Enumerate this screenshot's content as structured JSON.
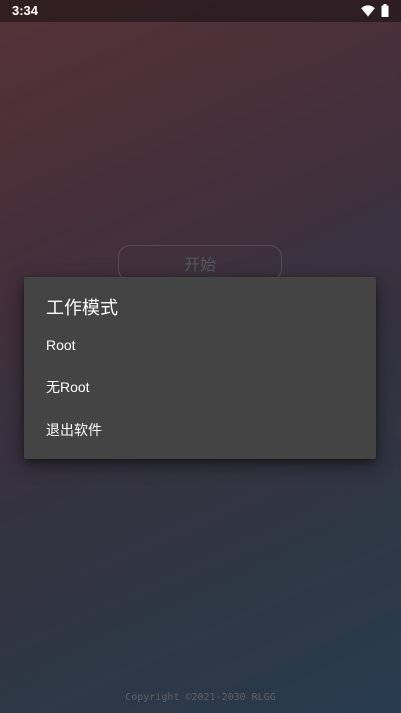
{
  "status_bar": {
    "time": "3:34",
    "icons": [
      "wifi-icon",
      "battery-icon"
    ]
  },
  "main": {
    "start_button_label": "开始"
  },
  "dialog": {
    "title": "工作模式",
    "items": [
      {
        "label": "Root"
      },
      {
        "label": "无Root"
      },
      {
        "label": "退出软件"
      }
    ]
  },
  "footer": {
    "copyright": "Copyright ©2021-2030 RLGG"
  },
  "colors": {
    "dialog_background": "#444444",
    "dialog_text": "#ffffff"
  }
}
